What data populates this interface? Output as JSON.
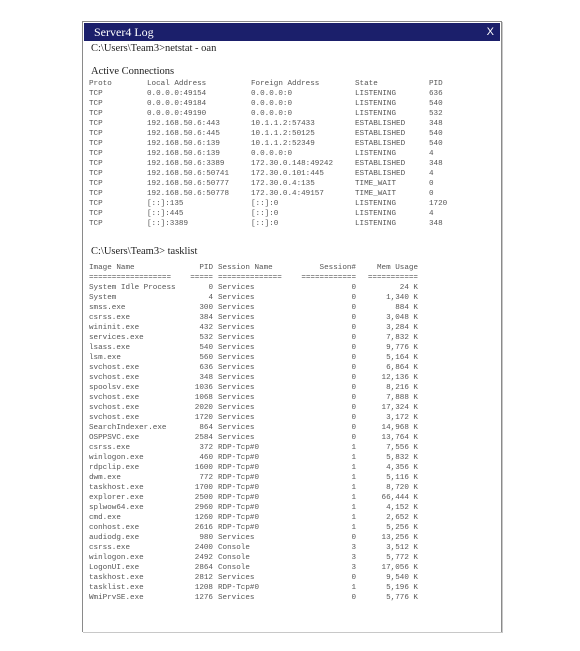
{
  "window": {
    "title": "Server4  Log",
    "close_label": "X",
    "titlebar_color": "#1b1f6b"
  },
  "netstat": {
    "prompt": "C:\\Users\\Team3>netstat - oan",
    "heading": "Active Connections",
    "headers": [
      "Proto",
      "Local Address",
      "Foreign Address",
      "State",
      "PID"
    ],
    "rows": [
      [
        "TCP",
        "0.0.0.0:49154",
        "0.0.0.0:0",
        "LISTENING",
        "636"
      ],
      [
        "TCP",
        "0.0.0.0:49184",
        "0.0.0.0:0",
        "LISTENING",
        "540"
      ],
      [
        "TCP",
        "0.0.0.0:49190",
        "0.0.0.0:0",
        "LISTENING",
        "532"
      ],
      [
        "TCP",
        "192.168.50.6:443",
        "10.1.1.2:57433",
        "ESTABLISHED",
        "348"
      ],
      [
        "TCP",
        "192.168.50.6:445",
        "10.1.1.2:50125",
        "ESTABLISHED",
        "540"
      ],
      [
        "TCP",
        "192.168.50.6:139",
        "10.1.1.2:52349",
        "ESTABLISHED",
        "540"
      ],
      [
        "TCP",
        "192.168.50.6:139",
        "0.0.0.0:0",
        "LISTENING",
        "4"
      ],
      [
        "TCP",
        "192.168.50.6:3389",
        "172.30.0.148:49242",
        "ESTABLISHED",
        "348"
      ],
      [
        "TCP",
        "192.168.50.6:50741",
        "172.30.0.101:445",
        "ESTABLISHED",
        "4"
      ],
      [
        "TCP",
        "192.168.50.6:50777",
        "172.30.0.4:135",
        "TIME_WAIT",
        "0"
      ],
      [
        "TCP",
        "192.168.50.6:50778",
        "172.30.0.4:49157",
        "TIME_WAIT",
        "0"
      ],
      [
        "TCP",
        "[::]:135",
        "[::]:0",
        "LISTENING",
        "1720"
      ],
      [
        "TCP",
        "[::]:445",
        "[::]:0",
        "LISTENING",
        "4"
      ],
      [
        "TCP",
        "[::]:3389",
        "[::]:0",
        "LISTENING",
        "348"
      ]
    ]
  },
  "tasklist": {
    "prompt": "C:\\Users\\Team3> tasklist",
    "headers": [
      "Image Name",
      "PID",
      "Session Name",
      "Session#",
      "Mem Usage"
    ],
    "separators": [
      "==================",
      "=====",
      "==============",
      "============",
      "==========="
    ],
    "rows": [
      [
        "System Idle Process",
        "0",
        "Services",
        "0",
        "24 K"
      ],
      [
        "System",
        "4",
        "Services",
        "0",
        "1,340 K"
      ],
      [
        "smss.exe",
        "300",
        "Services",
        "0",
        "884 K"
      ],
      [
        "csrss.exe",
        "384",
        "Services",
        "0",
        "3,048 K"
      ],
      [
        "wininit.exe",
        "432",
        "Services",
        "0",
        "3,284 K"
      ],
      [
        "services.exe",
        "532",
        "Services",
        "0",
        "7,832 K"
      ],
      [
        "lsass.exe",
        "540",
        "Services",
        "0",
        "9,776 K"
      ],
      [
        "lsm.exe",
        "560",
        "Services",
        "0",
        "5,164 K"
      ],
      [
        "svchost.exe",
        "636",
        "Services",
        "0",
        "6,864 K"
      ],
      [
        "svchost.exe",
        "348",
        "Services",
        "0",
        "12,136 K"
      ],
      [
        "spoolsv.exe",
        "1036",
        "Services",
        "0",
        "8,216 K"
      ],
      [
        "svchost.exe",
        "1068",
        "Services",
        "0",
        "7,888 K"
      ],
      [
        "svchost.exe",
        "2020",
        "Services",
        "0",
        "17,324 K"
      ],
      [
        "svchost.exe",
        "1720",
        "Services",
        "0",
        "3,172 K"
      ],
      [
        "SearchIndexer.exe",
        "864",
        "Services",
        "0",
        "14,968 K"
      ],
      [
        "OSPPSVC.exe",
        "2584",
        "Services",
        "0",
        "13,764 K"
      ],
      [
        "csrss.exe",
        "372",
        "RDP-Tcp#0",
        "1",
        "7,556 K"
      ],
      [
        "winlogon.exe",
        "460",
        "RDP-Tcp#0",
        "1",
        "5,832 K"
      ],
      [
        "rdpclip.exe",
        "1600",
        "RDP-Tcp#0",
        "1",
        "4,356 K"
      ],
      [
        "dwm.exe",
        "772",
        "RDP-Tcp#0",
        "1",
        "5,116 K"
      ],
      [
        "taskhost.exe",
        "1700",
        "RDP-Tcp#0",
        "1",
        "8,720 K"
      ],
      [
        "explorer.exe",
        "2500",
        "RDP-Tcp#0",
        "1",
        "66,444 K"
      ],
      [
        "splwow64.exe",
        "2960",
        "RDP-Tcp#0",
        "1",
        "4,152 K"
      ],
      [
        "cmd.exe",
        "1260",
        "RDP-Tcp#0",
        "1",
        "2,652 K"
      ],
      [
        "conhost.exe",
        "2616",
        "RDP-Tcp#0",
        "1",
        "5,256 K"
      ],
      [
        "audiodg.exe",
        "980",
        "Services",
        "0",
        "13,256 K"
      ],
      [
        "csrss.exe",
        "2400",
        "Console",
        "3",
        "3,512 K"
      ],
      [
        "winlogon.exe",
        "2492",
        "Console",
        "3",
        "5,772 K"
      ],
      [
        "LogonUI.exe",
        "2864",
        "Console",
        "3",
        "17,056 K"
      ],
      [
        "taskhost.exe",
        "2812",
        "Services",
        "0",
        "9,540 K"
      ],
      [
        "tasklist.exe",
        "1208",
        "RDP-Tcp#0",
        "1",
        "5,196 K"
      ],
      [
        "WmiPrvSE.exe",
        "1276",
        "Services",
        "0",
        "5,776 K"
      ]
    ]
  }
}
